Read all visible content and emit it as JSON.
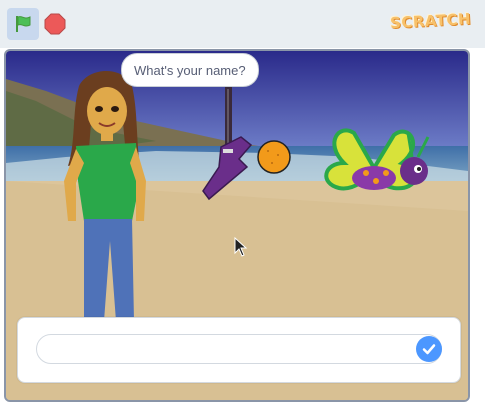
{
  "toolbar": {
    "green_flag_icon": "green-flag-icon",
    "stop_icon": "stop-icon",
    "logo_text": "SCRATCH"
  },
  "stage": {
    "speech_bubble": "What's your name?",
    "ask_input_value": "",
    "ask_input_placeholder": "",
    "submit_icon": "check-icon"
  },
  "colors": {
    "toolbar_bg": "#e9eef2",
    "flag_active": "#c8d8ee",
    "stop_red": "#ec5959",
    "submit_blue": "#4c97ff"
  }
}
